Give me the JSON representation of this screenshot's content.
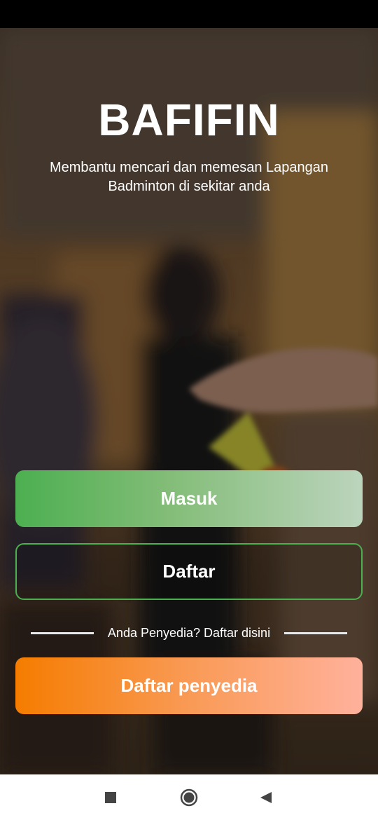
{
  "app": {
    "title": "BAFIFIN",
    "tagline": "Membantu mencari dan memesan Lapangan Badminton di sekitar anda"
  },
  "buttons": {
    "login_label": "Masuk",
    "register_label": "Daftar",
    "provider_register_label": "Daftar penyedia"
  },
  "divider": {
    "text": "Anda Penyedia? Daftar disini"
  },
  "colors": {
    "green_accent": "#4caf50",
    "orange_accent": "#f57c00",
    "text": "#ffffff"
  },
  "nav": {
    "icons": [
      "recents-square-icon",
      "home-circle-icon",
      "back-triangle-icon"
    ]
  }
}
